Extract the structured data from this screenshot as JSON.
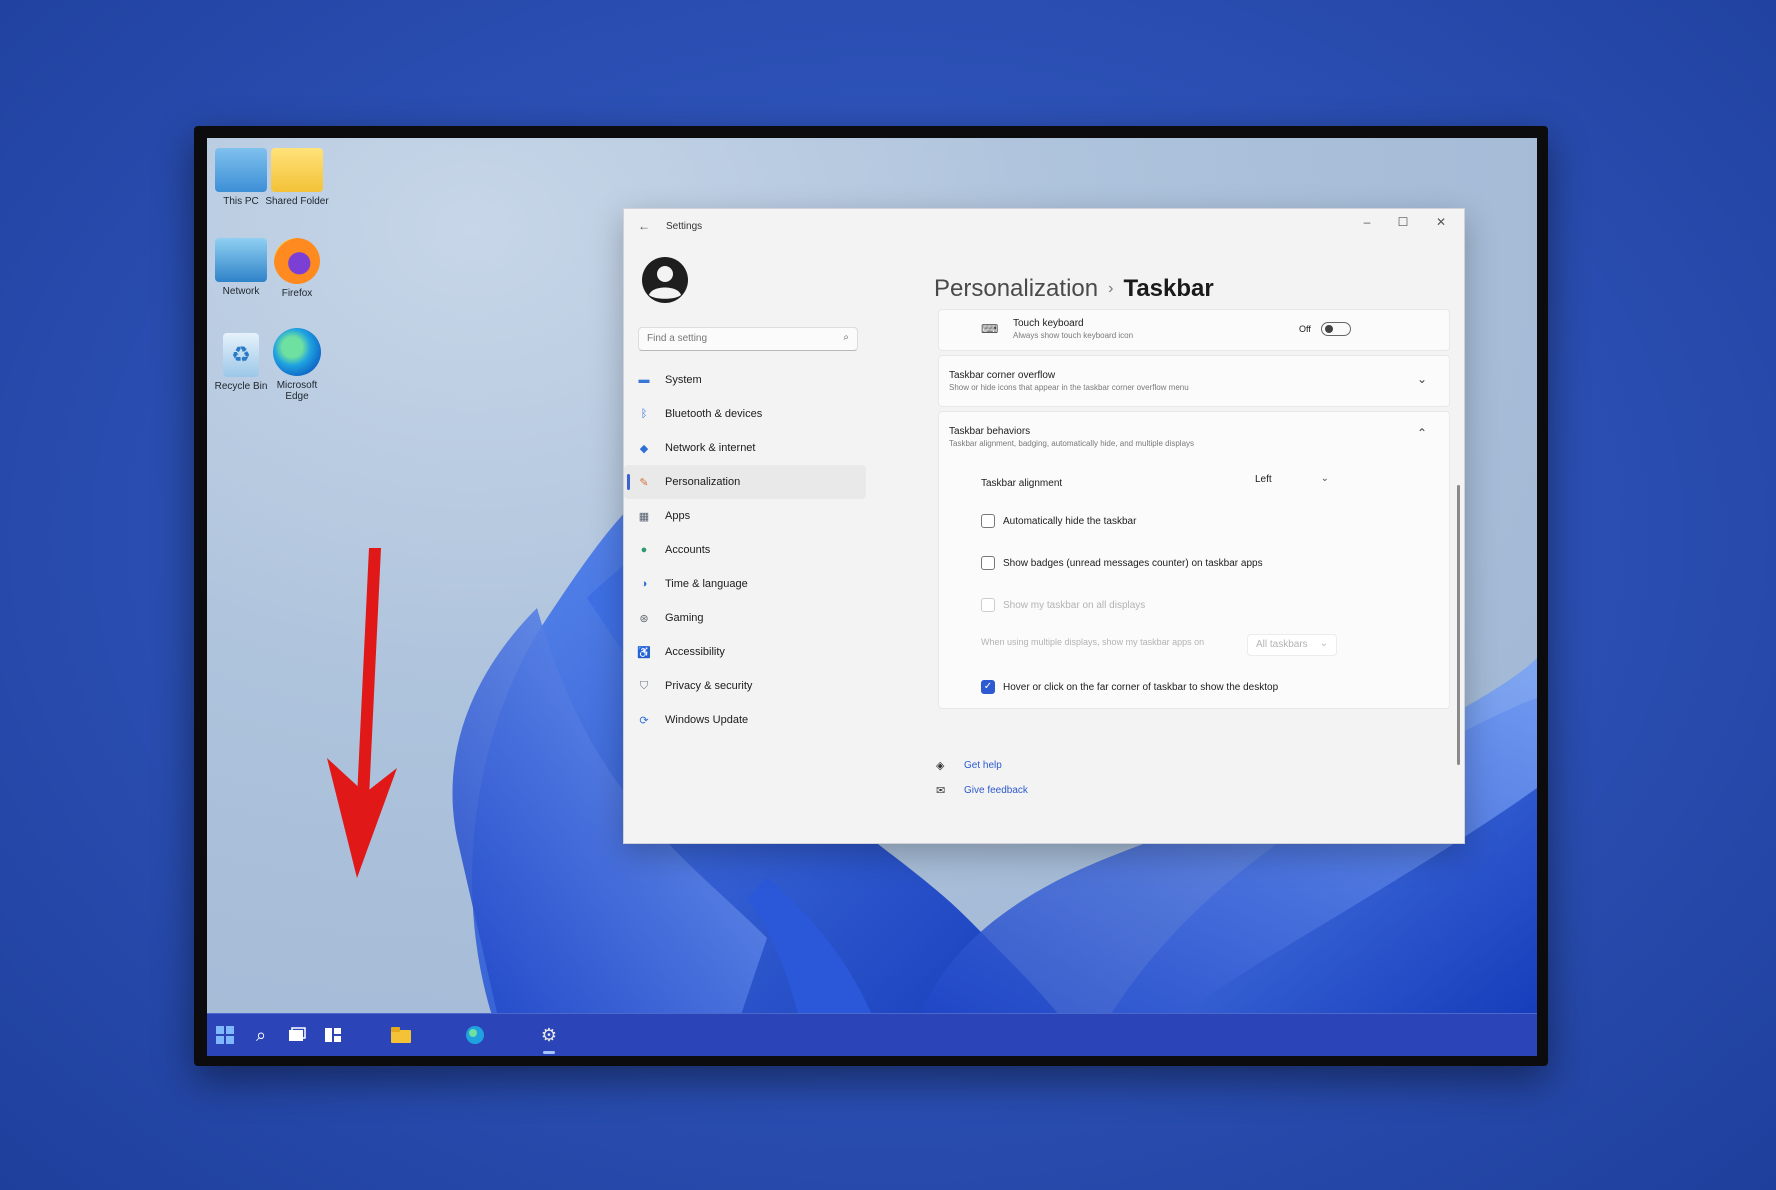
{
  "desktop": {
    "icons": [
      {
        "label": "This PC",
        "icon": "monitor-icon"
      },
      {
        "label": "Shared Folder",
        "icon": "folder-icon"
      },
      {
        "label": "Network",
        "icon": "network-icon"
      },
      {
        "label": "Firefox",
        "icon": "firefox-icon"
      },
      {
        "label": "Recycle Bin",
        "icon": "recycle-bin-icon"
      },
      {
        "label": "Microsoft Edge",
        "icon": "edge-icon"
      }
    ]
  },
  "settings": {
    "title": "Settings",
    "back_icon": "back-arrow-icon",
    "window_controls": {
      "minimize": "–",
      "maximize": "☐",
      "close": "✕"
    },
    "search_placeholder": "Find a setting",
    "nav": [
      {
        "label": "System",
        "icon": "system-icon",
        "color": "#3477d6"
      },
      {
        "label": "Bluetooth & devices",
        "icon": "bluetooth-icon",
        "color": "#2f6fd8"
      },
      {
        "label": "Network & internet",
        "icon": "wifi-icon",
        "color": "#2f6fd8"
      },
      {
        "label": "Personalization",
        "icon": "brush-icon",
        "color": "#d4743a",
        "active": true
      },
      {
        "label": "Apps",
        "icon": "apps-icon",
        "color": "#556070"
      },
      {
        "label": "Accounts",
        "icon": "accounts-icon",
        "color": "#2f9a6f"
      },
      {
        "label": "Time & language",
        "icon": "globe-icon",
        "color": "#2f6fd8"
      },
      {
        "label": "Gaming",
        "icon": "gaming-icon",
        "color": "#606870"
      },
      {
        "label": "Accessibility",
        "icon": "accessibility-icon",
        "color": "#2f6fd8"
      },
      {
        "label": "Privacy & security",
        "icon": "shield-icon",
        "color": "#707880"
      },
      {
        "label": "Windows Update",
        "icon": "update-icon",
        "color": "#2f6fd8"
      }
    ],
    "breadcrumb": {
      "parent": "Personalization",
      "separator": "›",
      "current": "Taskbar"
    },
    "touch_keyboard": {
      "title": "Touch keyboard",
      "subtitle": "Always show touch keyboard icon",
      "state": "Off"
    },
    "corner_overflow": {
      "title": "Taskbar corner overflow",
      "subtitle": "Show or hide icons that appear in the taskbar corner overflow menu"
    },
    "behaviors": {
      "title": "Taskbar behaviors",
      "subtitle": "Taskbar alignment, badging, automatically hide, and multiple displays",
      "alignment_label": "Taskbar alignment",
      "alignment_value": "Left",
      "auto_hide": "Automatically hide the taskbar",
      "badges": "Show badges (unread messages counter) on taskbar apps",
      "all_displays": "Show my taskbar on all displays",
      "multi_display": "When using multiple displays, show my taskbar apps on",
      "multi_display_value": "All taskbars",
      "show_desktop": "Hover or click on the far corner of taskbar to show the desktop"
    },
    "links": {
      "help": "Get help",
      "feedback": "Give feedback"
    }
  },
  "colors": {
    "accent": "#2d5ad0",
    "arrow": "#e01818",
    "taskbar": "#2b45b8"
  }
}
